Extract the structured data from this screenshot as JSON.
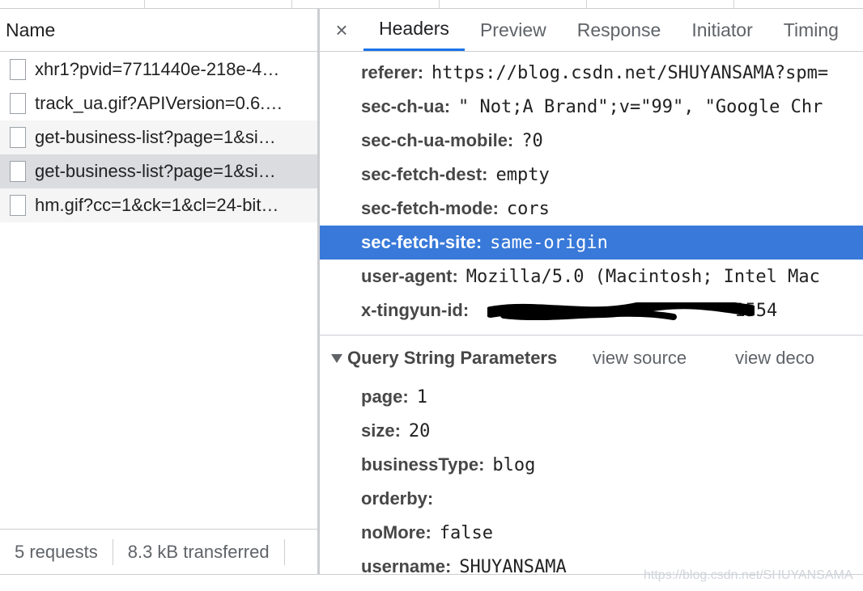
{
  "requests_panel": {
    "column_header": "Name",
    "rows": [
      {
        "name": "xhr1?pvid=7711440e-218e-4…"
      },
      {
        "name": "track_ua.gif?APIVersion=0.6.…"
      },
      {
        "name": "get-business-list?page=1&si…"
      },
      {
        "name": "get-business-list?page=1&si…"
      },
      {
        "name": "hm.gif?cc=1&ck=1&cl=24-bit…"
      }
    ],
    "status": {
      "count": "5 requests",
      "transferred": "8.3 kB transferred"
    }
  },
  "detail_tabs": {
    "close": "×",
    "items": [
      {
        "label": "Headers"
      },
      {
        "label": "Preview"
      },
      {
        "label": "Response"
      },
      {
        "label": "Initiator"
      },
      {
        "label": "Timing"
      }
    ],
    "active": "Headers"
  },
  "request_headers": [
    {
      "key": "referer:",
      "value": "https://blog.csdn.net/SHUYANSAMA?spm="
    },
    {
      "key": "sec-ch-ua:",
      "value": "\" Not;A Brand\";v=\"99\", \"Google Chr"
    },
    {
      "key": "sec-ch-ua-mobile:",
      "value": "?0"
    },
    {
      "key": "sec-fetch-dest:",
      "value": "empty"
    },
    {
      "key": "sec-fetch-mode:",
      "value": "cors"
    },
    {
      "key": "sec-fetch-site:",
      "value": "same-origin"
    },
    {
      "key": "user-agent:",
      "value": "Mozilla/5.0 (Macintosh; Intel Mac"
    },
    {
      "key": "x-tingyun-id:",
      "value": "1554"
    }
  ],
  "query_section": {
    "title": "Query String Parameters",
    "view_source": "view source",
    "view_decoded": "view deco",
    "params": [
      {
        "key": "page:",
        "value": "1"
      },
      {
        "key": "size:",
        "value": "20"
      },
      {
        "key": "businessType:",
        "value": "blog"
      },
      {
        "key": "orderby:",
        "value": ""
      },
      {
        "key": "noMore:",
        "value": "false"
      },
      {
        "key": "username:",
        "value": "SHUYANSAMA"
      }
    ]
  },
  "watermark": "https://blog.csdn.net/SHUYANSAMA",
  "colors": {
    "selection": "#3879d9",
    "active_tab": "#1a73e8"
  }
}
